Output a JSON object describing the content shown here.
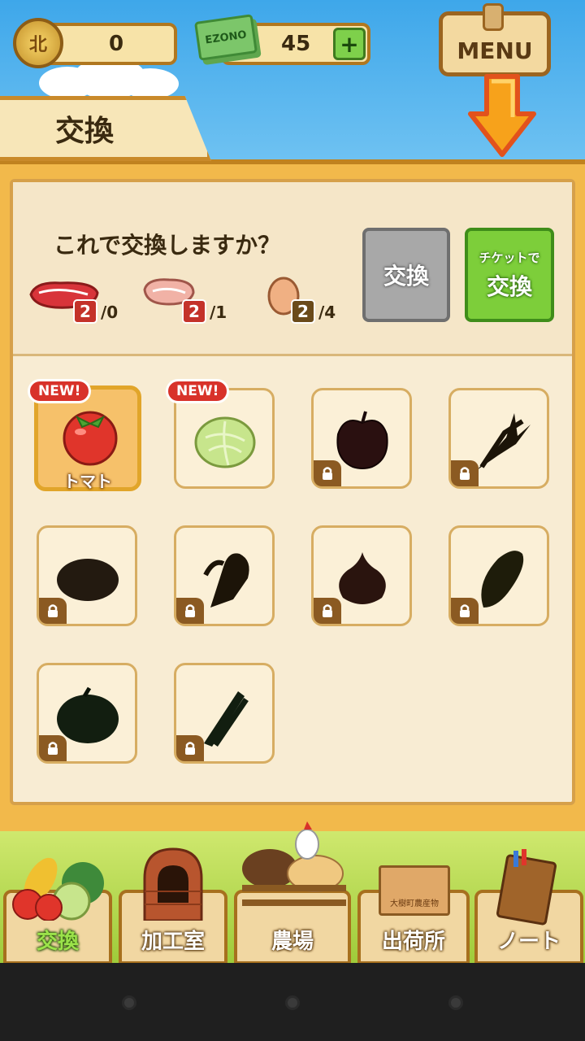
{
  "header": {
    "coin_icon_label": "北",
    "coins": "0",
    "ticket_icon_label": "EZONO",
    "tickets": "45",
    "plus_label": "+",
    "menu_label": "MENU"
  },
  "title": "交換",
  "confirm": {
    "question": "これで交換しますか？",
    "ingredients": [
      {
        "icon": "beef-icon",
        "required": "2",
        "owned": "/0"
      },
      {
        "icon": "pork-icon",
        "required": "2",
        "owned": "/1"
      },
      {
        "icon": "egg-icon",
        "required": "2",
        "owned": "/4"
      }
    ],
    "exchange_label": "交換",
    "ticket_exchange_small": "チケットで",
    "ticket_exchange_big": "交換"
  },
  "items": [
    {
      "icon": "tomato-icon",
      "label": "トマト",
      "new": "NEW!",
      "locked": false,
      "selected": true
    },
    {
      "icon": "cabbage-icon",
      "label": "",
      "new": "NEW!",
      "locked": false,
      "selected": false
    },
    {
      "icon": "apple-icon",
      "label": "",
      "new": "",
      "locked": true
    },
    {
      "icon": "leek-icon",
      "label": "",
      "new": "",
      "locked": true
    },
    {
      "icon": "potato-icon",
      "label": "",
      "new": "",
      "locked": true
    },
    {
      "icon": "wheat-icon",
      "label": "",
      "new": "",
      "locked": true
    },
    {
      "icon": "onion-icon",
      "label": "",
      "new": "",
      "locked": true
    },
    {
      "icon": "corn-icon",
      "label": "",
      "new": "",
      "locked": true
    },
    {
      "icon": "pumpkin-icon",
      "label": "",
      "new": "",
      "locked": true
    },
    {
      "icon": "asparagus-icon",
      "label": "",
      "new": "",
      "locked": true
    }
  ],
  "nav": {
    "exchange": "交換",
    "workshop": "加工室",
    "farm": "農場",
    "shipping": "出荷所",
    "notebook": "ノート",
    "crate_text": "大樹町農産物"
  },
  "colors": {
    "sky": "#3ea7ea",
    "panel": "#f2b94b",
    "exchange_button": "#a8a8a8",
    "ticket_button": "#7dce3a",
    "badge_red": "#c4322a"
  }
}
